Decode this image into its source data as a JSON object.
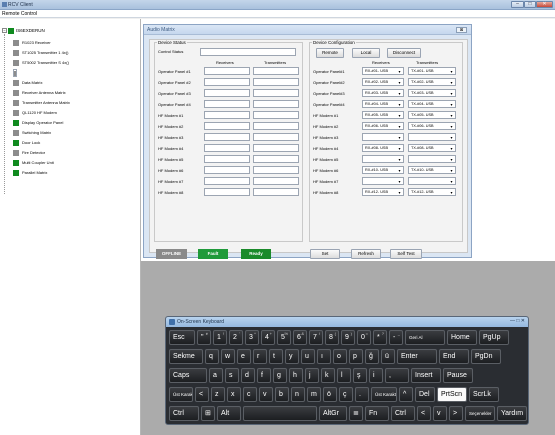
{
  "window": {
    "title": "RCV Client",
    "min": "–",
    "max": "□",
    "close": "✕"
  },
  "menu": {
    "item": "Remote Control"
  },
  "tree": {
    "root": {
      "label": "IS6EXDERUN",
      "expander": "−"
    },
    "nodes": [
      {
        "label": "R1023 Receiver",
        "color": "gray"
      },
      {
        "label": "ST1025 Transmitter 1 4x()",
        "color": "gray"
      },
      {
        "label": "ST5002 Transmitter S 4x()",
        "color": "gray"
      },
      {
        "label": "Audio Matrix",
        "color": "gray",
        "selected": true
      },
      {
        "label": "Data Matrix",
        "color": "gray"
      },
      {
        "label": "Receiver Antenna Matrix",
        "color": "gray"
      },
      {
        "label": "Transmitter Antenna Matrix",
        "color": "gray"
      },
      {
        "label": "QL1120 HF Modem",
        "color": "gray"
      },
      {
        "label": "Display Operator Panel",
        "color": "green"
      },
      {
        "label": "Switching Matrix",
        "color": "gray"
      },
      {
        "label": "Door Lock",
        "color": "green"
      },
      {
        "label": "Fire Detector",
        "color": "gray"
      },
      {
        "label": "Multi Coupler Unit",
        "color": "green"
      },
      {
        "label": "Parallel Matrix",
        "color": "green"
      }
    ]
  },
  "audio_matrix": {
    "title": "Audio Matrix",
    "close": "⊠",
    "device_status": {
      "group": "Device Status",
      "control_status": "Control Status",
      "receivers": "Receivers",
      "transmitters": "Transmitters",
      "rows": [
        "Operator Panel #1",
        "Operator Panel #2",
        "Operator Panel #3",
        "Operator Panel #4",
        "HF Modem #1",
        "HF Modem #2",
        "HF Modem #3",
        "HF Modem #4",
        "HF Modem #5",
        "HF Modem #6",
        "HF Modem #7",
        "HF Modem #8"
      ]
    },
    "device_config": {
      "group": "Device Configuration",
      "remote": "Remote",
      "local": "Local",
      "disconnect": "Disconnect",
      "receivers": "Receivers",
      "transmitters": "Transmitters",
      "rows": [
        {
          "label": "Operator Panel#1",
          "rx": "RX-#01- USB",
          "tx": "TX-#01- USB"
        },
        {
          "label": "Operator Panel#2",
          "rx": "RX-#02- USB",
          "tx": "TX-#02- USB"
        },
        {
          "label": "Operator Panel#3",
          "rx": "RX-#03- USB",
          "tx": "TX-#03- USB"
        },
        {
          "label": "Operator Panel#4",
          "rx": "RX-#04- USB",
          "tx": "TX-#04- USB"
        },
        {
          "label": "HF Modem #1",
          "rx": "RX-#05- USB",
          "tx": "TX-#05- USB"
        },
        {
          "label": "HF Modem #2",
          "rx": "RX-#06- USB",
          "tx": "TX-#06- USB"
        },
        {
          "label": "HF Modem #3",
          "rx": "",
          "tx": ""
        },
        {
          "label": "HF Modem #4",
          "rx": "RX-#08- USB",
          "tx": "TX-#08- USB"
        },
        {
          "label": "HF Modem #5",
          "rx": "",
          "tx": ""
        },
        {
          "label": "HF Modem #6",
          "rx": "RX-#10- USB",
          "tx": "TX-#10- USB"
        },
        {
          "label": "HF Modem #7",
          "rx": "",
          "tx": ""
        },
        {
          "label": "HF Modem #8",
          "rx": "RX-#12- USB",
          "tx": "TX-#12- USB"
        }
      ]
    },
    "status": {
      "offline": "OFFLINE",
      "fault": "Fault",
      "ready": "Ready"
    },
    "buttons": {
      "set": "Set",
      "refresh": "Refresh",
      "self_test": "Self Test"
    },
    "colors": {
      "offline": "#8a8a8a",
      "fault": "#1f9a3a",
      "ready": "#1a8a2a"
    }
  },
  "keyboard": {
    "title": "On-Screen Keyboard",
    "controls": "—  □  ✕",
    "rows": [
      [
        {
          "t": "Esc"
        },
        {
          "t": "\"",
          "s": "é"
        },
        {
          "t": "1",
          "s": "!"
        },
        {
          "t": "2",
          "s": "'"
        },
        {
          "t": "3",
          "s": "^"
        },
        {
          "t": "4",
          "s": "+"
        },
        {
          "t": "5",
          "s": "%"
        },
        {
          "t": "6",
          "s": "&"
        },
        {
          "t": "7",
          "s": "/"
        },
        {
          "t": "8",
          "s": "("
        },
        {
          "t": "9",
          "s": ")"
        },
        {
          "t": "0",
          "s": "="
        },
        {
          "t": "*",
          "s": "?"
        },
        {
          "t": "-",
          "s": "_"
        },
        {
          "t": "Geri Al"
        },
        {
          "t": "Home"
        },
        {
          "t": "PgUp"
        }
      ],
      [
        {
          "t": "Sekme"
        },
        {
          "t": "q"
        },
        {
          "t": "w"
        },
        {
          "t": "e"
        },
        {
          "t": "r"
        },
        {
          "t": "t"
        },
        {
          "t": "y"
        },
        {
          "t": "u"
        },
        {
          "t": "ı"
        },
        {
          "t": "o"
        },
        {
          "t": "p"
        },
        {
          "t": "ğ"
        },
        {
          "t": "ü"
        },
        {
          "t": "Enter"
        },
        {
          "t": "End"
        },
        {
          "t": "PgDn"
        }
      ],
      [
        {
          "t": "Caps"
        },
        {
          "t": "a"
        },
        {
          "t": "s"
        },
        {
          "t": "d"
        },
        {
          "t": "f"
        },
        {
          "t": "g"
        },
        {
          "t": "h"
        },
        {
          "t": "j"
        },
        {
          "t": "k"
        },
        {
          "t": "l"
        },
        {
          "t": "ş"
        },
        {
          "t": "i"
        },
        {
          "t": ","
        },
        {
          "t": "Insert"
        },
        {
          "t": "Pause"
        }
      ],
      [
        {
          "t": "Üst Karakter"
        },
        {
          "t": "<"
        },
        {
          "t": "z"
        },
        {
          "t": "x"
        },
        {
          "t": "c"
        },
        {
          "t": "v"
        },
        {
          "t": "b"
        },
        {
          "t": "n"
        },
        {
          "t": "m"
        },
        {
          "t": "ö"
        },
        {
          "t": "ç"
        },
        {
          "t": "."
        },
        {
          "t": "Üst Karakter"
        },
        {
          "t": "^"
        },
        {
          "t": "Del"
        },
        {
          "t": "PrtScn"
        },
        {
          "t": "ScrLk"
        }
      ],
      [
        {
          "t": "Ctrl"
        },
        {
          "t": "⊞"
        },
        {
          "t": "Alt"
        },
        {
          "t": ""
        },
        {
          "t": "AltGr"
        },
        {
          "t": "≣"
        },
        {
          "t": "Fn"
        },
        {
          "t": "Ctrl"
        },
        {
          "t": "<"
        },
        {
          "t": "v"
        },
        {
          "t": ">"
        },
        {
          "t": "Seçenekler"
        },
        {
          "t": "Yardım"
        }
      ]
    ]
  }
}
